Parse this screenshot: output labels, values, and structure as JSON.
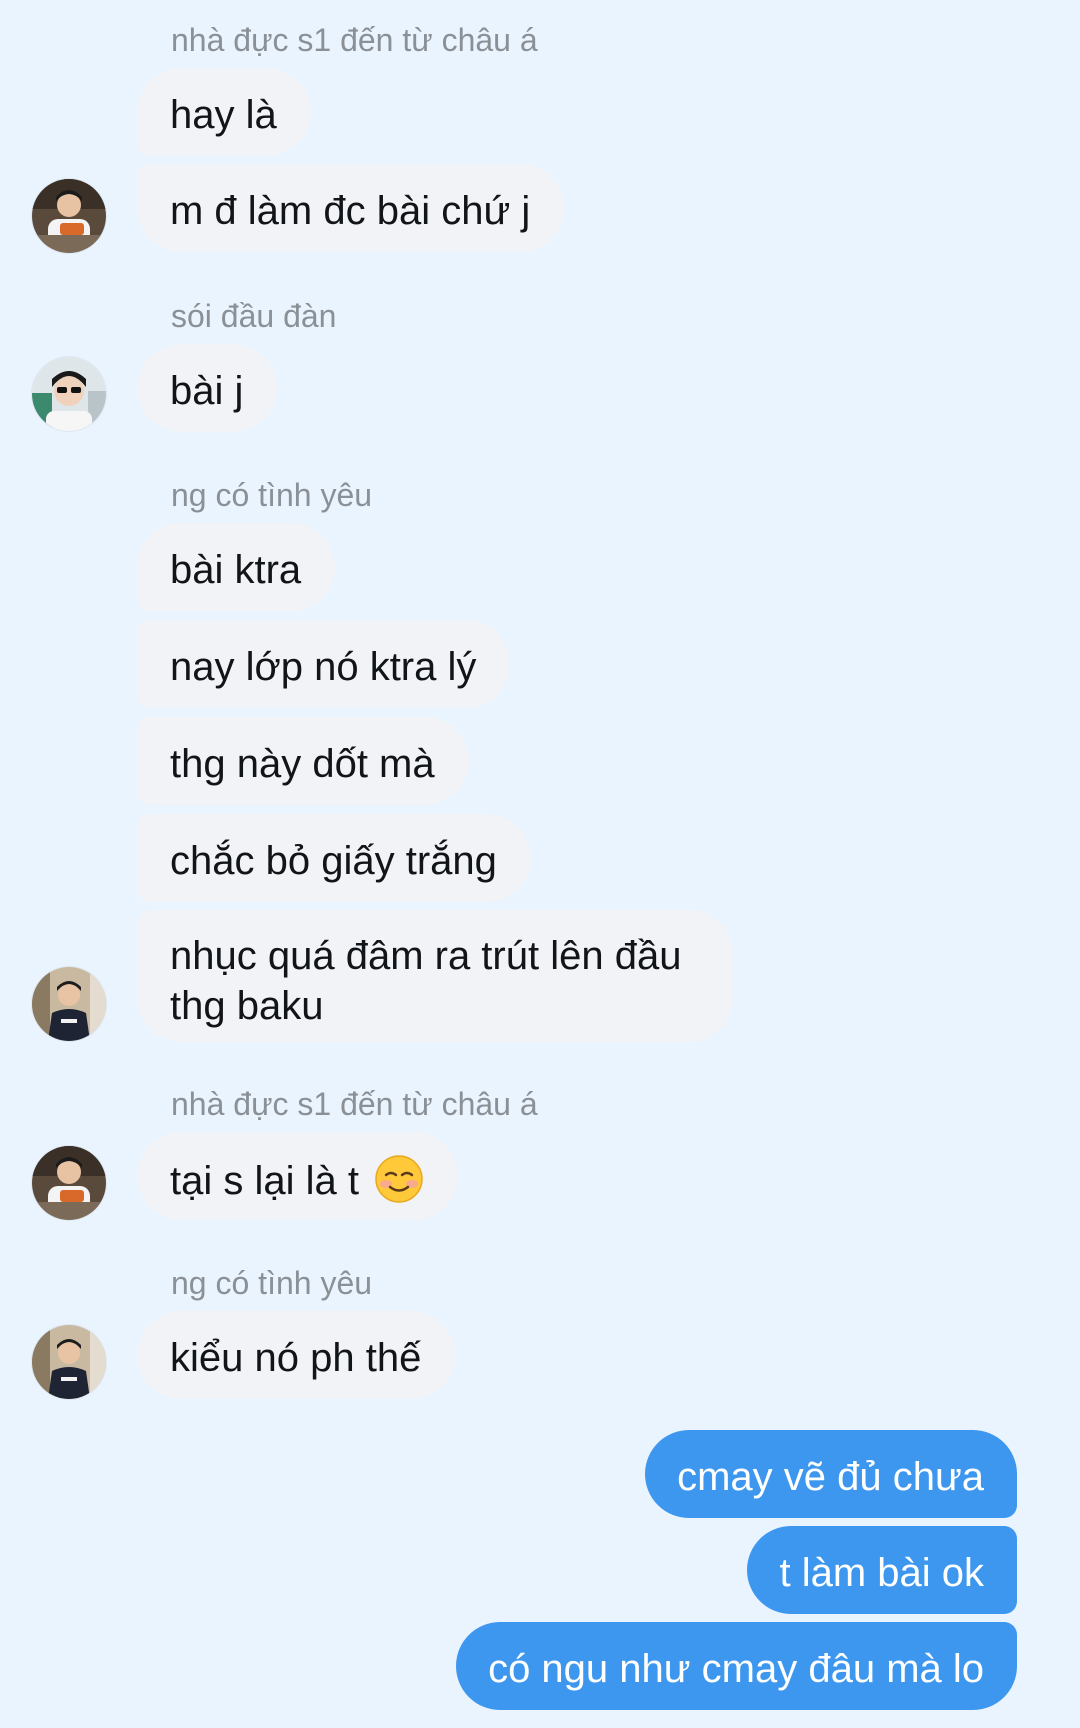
{
  "colors": {
    "background": "#EAF4FE",
    "incoming_bubble": "#F1F3F6",
    "outgoing_bubble": "#3E97EF",
    "sender_name": "#8A9096"
  },
  "messages": [
    {
      "type": "sender",
      "text": "nhà đực s1 đến từ châu á"
    },
    {
      "type": "incoming",
      "text": "hay là"
    },
    {
      "type": "incoming",
      "text": "m đ làm đc bài chứ j",
      "avatar": "avatar-eating-icon"
    },
    {
      "type": "sender",
      "text": "sói đầu đàn"
    },
    {
      "type": "incoming",
      "text": "bài j",
      "avatar": "avatar-sunglasses-icon"
    },
    {
      "type": "sender",
      "text": "ng có tình yêu"
    },
    {
      "type": "incoming",
      "text": "bài ktra"
    },
    {
      "type": "incoming",
      "text": "nay lớp nó ktra lý"
    },
    {
      "type": "incoming",
      "text": "thg này dốt mà"
    },
    {
      "type": "incoming",
      "text": "chắc bỏ giấy trắng"
    },
    {
      "type": "incoming",
      "text": "nhục quá đâm ra trút lên đầu thg baku",
      "avatar": "avatar-hoodie-icon"
    },
    {
      "type": "sender",
      "text": "nhà đực s1 đến từ châu á"
    },
    {
      "type": "incoming",
      "text": "tại s lại là t",
      "emoji": "smiling-face-emoji-icon",
      "avatar": "avatar-eating-icon"
    },
    {
      "type": "sender",
      "text": "ng có tình yêu"
    },
    {
      "type": "incoming",
      "text": "kiểu nó ph thế",
      "avatar": "avatar-hoodie-icon"
    },
    {
      "type": "outgoing",
      "text": "cmay vẽ đủ chưa"
    },
    {
      "type": "outgoing",
      "text": "t làm bài ok"
    },
    {
      "type": "outgoing",
      "text": "có ngu như cmay đâu mà lo"
    }
  ]
}
